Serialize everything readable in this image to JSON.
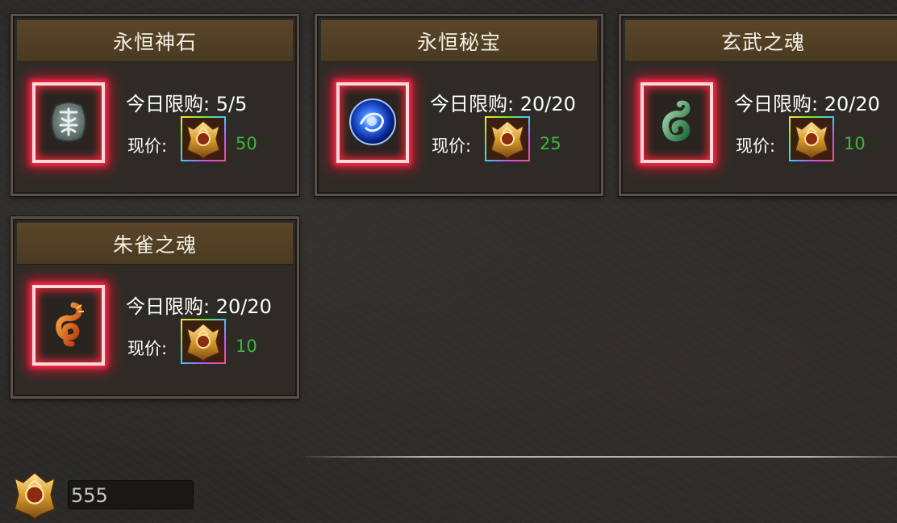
{
  "shop": {
    "items": [
      {
        "name": "永恒神石",
        "limit": "今日限购: 5/5",
        "price_label": "现价:",
        "price": "50",
        "icon": "stone-rune-icon"
      },
      {
        "name": "永恒秘宝",
        "limit": "今日限购: 20/20",
        "price_label": "现价:",
        "price": "25",
        "icon": "blue-orb-icon"
      },
      {
        "name": "玄武之魂",
        "limit": "今日限购: 20/20",
        "price_label": "现价:",
        "price": "10",
        "icon": "jade-serpent-icon"
      },
      {
        "name": "朱雀之魂",
        "limit": "今日限购: 20/20",
        "price_label": "现价:",
        "price": "10",
        "icon": "fire-dragon-icon"
      }
    ]
  },
  "wallet": {
    "balance": "555",
    "currency_icon": "golden-emblem-icon"
  },
  "colors": {
    "price_green": "#3fb43f",
    "header_brown": "#4f3d24",
    "glow_red": "#ff2b45"
  }
}
